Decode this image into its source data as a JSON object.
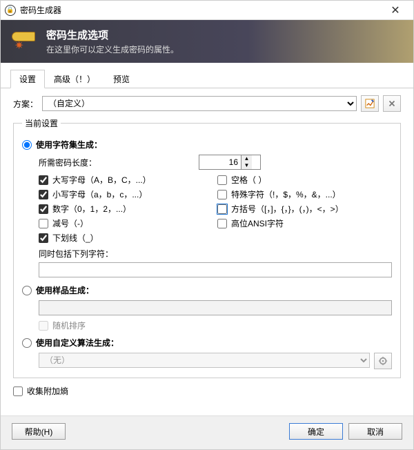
{
  "window": {
    "title": "密码生成器"
  },
  "banner": {
    "title": "密码生成选项",
    "subtitle": "在这里你可以定义生成密码的属性。"
  },
  "tabs": {
    "settings": "设置",
    "advanced": "高级（！）",
    "preview": "预览"
  },
  "scheme": {
    "label": "方案：",
    "selected": "（自定义）"
  },
  "fieldset_legend": "当前设置",
  "gen_charset": {
    "label": "使用字符集生成：",
    "checked": true
  },
  "length": {
    "label": "所需密码长度：",
    "value": "16"
  },
  "opts": {
    "upper": {
      "label": "大写字母（A，B，C，...）",
      "checked": true
    },
    "space": {
      "label": "空格（ ）",
      "checked": false
    },
    "lower": {
      "label": "小写字母（a，b，c，...）",
      "checked": true
    },
    "special": {
      "label": "特殊字符（!，$，%，&，...）",
      "checked": false
    },
    "digit": {
      "label": "数字（0，1，2，...）",
      "checked": true
    },
    "bracket": {
      "label": "方括号（[，]，{，}，(，)，<，>）",
      "checked": false
    },
    "minus": {
      "label": "减号（-）",
      "checked": false
    },
    "highansi": {
      "label": "高位ANSI字符",
      "checked": false
    },
    "underscore": {
      "label": "下划线（_）",
      "checked": true
    }
  },
  "also_include": {
    "label": "同时包括下列字符：",
    "value": ""
  },
  "gen_pattern": {
    "label": "使用样品生成：",
    "checked": false,
    "value": "",
    "random_permute": "随机排序"
  },
  "gen_algo": {
    "label": "使用自定义算法生成：",
    "checked": false,
    "selected": "（无）"
  },
  "collect_entropy": {
    "label": "收集附加熵",
    "checked": false
  },
  "buttons": {
    "help": "帮助(H)",
    "ok": "确定",
    "cancel": "取消"
  }
}
